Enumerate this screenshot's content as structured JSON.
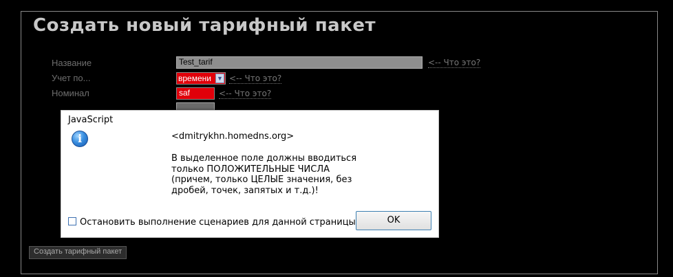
{
  "form": {
    "title": "Создать новый тарифный пакет",
    "fields": {
      "name_label": "Название",
      "name_value": "Test_tarif",
      "type_label": "Учет по...",
      "type_value": "времени",
      "nominal_label": "Номинал",
      "nominal_value": "saf"
    },
    "what_is_this": "<-- Что это?",
    "submit_label": "Создать тарифный пакет",
    "colors": {
      "background": "#000000",
      "error_field": "#e0000a",
      "label": "#6e6e6e"
    }
  },
  "dialog": {
    "title": "JavaScript",
    "host": "<dmitrykhn.homedns.org>",
    "message_lines": [
      "В выделенное поле должны вводиться",
      "только ПОЛОЖИТЕЛЬНЫЕ ЧИСЛА",
      "(причем, только ЦЕЛЫЕ значения, без",
      "дробей, точек, запятых и т.д.)!"
    ],
    "stop_scripts_label": "Остановить выполнение сценариев для данной страницы",
    "ok_label": "OK",
    "icon": "info-icon"
  }
}
